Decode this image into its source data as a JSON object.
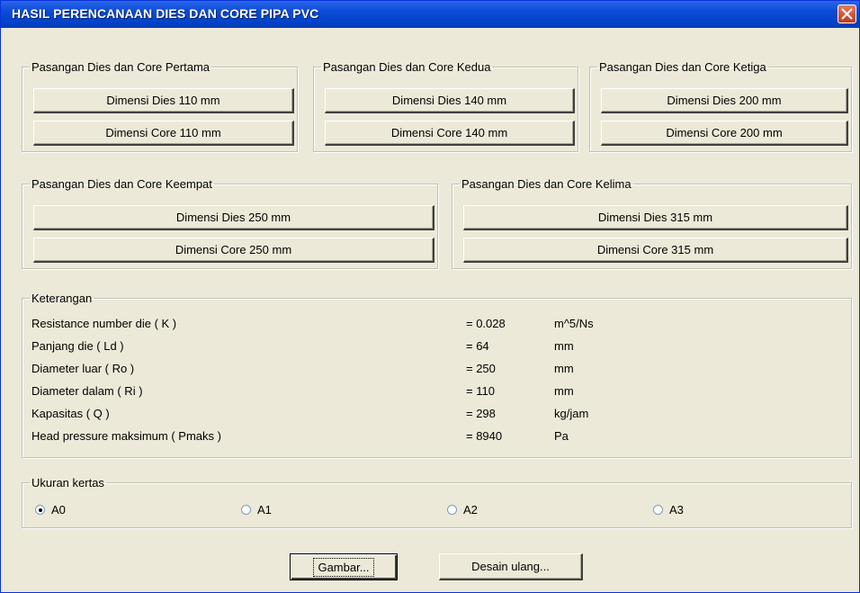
{
  "window": {
    "title": "HASIL PERENCANAAN DIES DAN CORE PIPA PVC"
  },
  "groups": [
    {
      "legend": "Pasangan Dies dan Core Pertama",
      "dies": "Dimensi Dies 110 mm",
      "core": "Dimensi Core 110 mm"
    },
    {
      "legend": "Pasangan Dies dan Core Kedua",
      "dies": "Dimensi Dies 140 mm",
      "core": "Dimensi Core 140 mm"
    },
    {
      "legend": "Pasangan Dies dan Core Ketiga",
      "dies": "Dimensi Dies 200 mm",
      "core": "Dimensi Core 200 mm"
    },
    {
      "legend": "Pasangan Dies dan Core Keempat",
      "dies": "Dimensi Dies 250 mm",
      "core": "Dimensi Core 250 mm"
    },
    {
      "legend": "Pasangan Dies dan Core Kelima",
      "dies": "Dimensi Dies 315 mm",
      "core": "Dimensi Core 315 mm"
    }
  ],
  "keterangan": {
    "legend": "Keterangan",
    "rows": [
      {
        "label": "Resistance number die  ( K )",
        "value": "= 0.028",
        "unit": "m^5/Ns"
      },
      {
        "label": "Panjang die  ( Ld )",
        "value": "= 64",
        "unit": "mm"
      },
      {
        "label": "Diameter luar  ( Ro )",
        "value": "= 250",
        "unit": "mm"
      },
      {
        "label": "Diameter dalam  ( Ri )",
        "value": "= 110",
        "unit": "mm"
      },
      {
        "label": "Kapasitas  ( Q )",
        "value": "= 298",
        "unit": "kg/jam"
      },
      {
        "label": "Head pressure maksimum  ( Pmaks )",
        "value": "= 8940",
        "unit": "Pa"
      }
    ]
  },
  "paper": {
    "legend": "Ukuran kertas",
    "options": [
      "A0",
      "A1",
      "A2",
      "A3"
    ],
    "selected": "A0"
  },
  "actions": {
    "draw": "Gambar...",
    "redesign": "Desain ulang..."
  },
  "colors": {
    "titlebar": "#0a4bd6",
    "face": "#ece9d8",
    "close": "#c0391a"
  }
}
